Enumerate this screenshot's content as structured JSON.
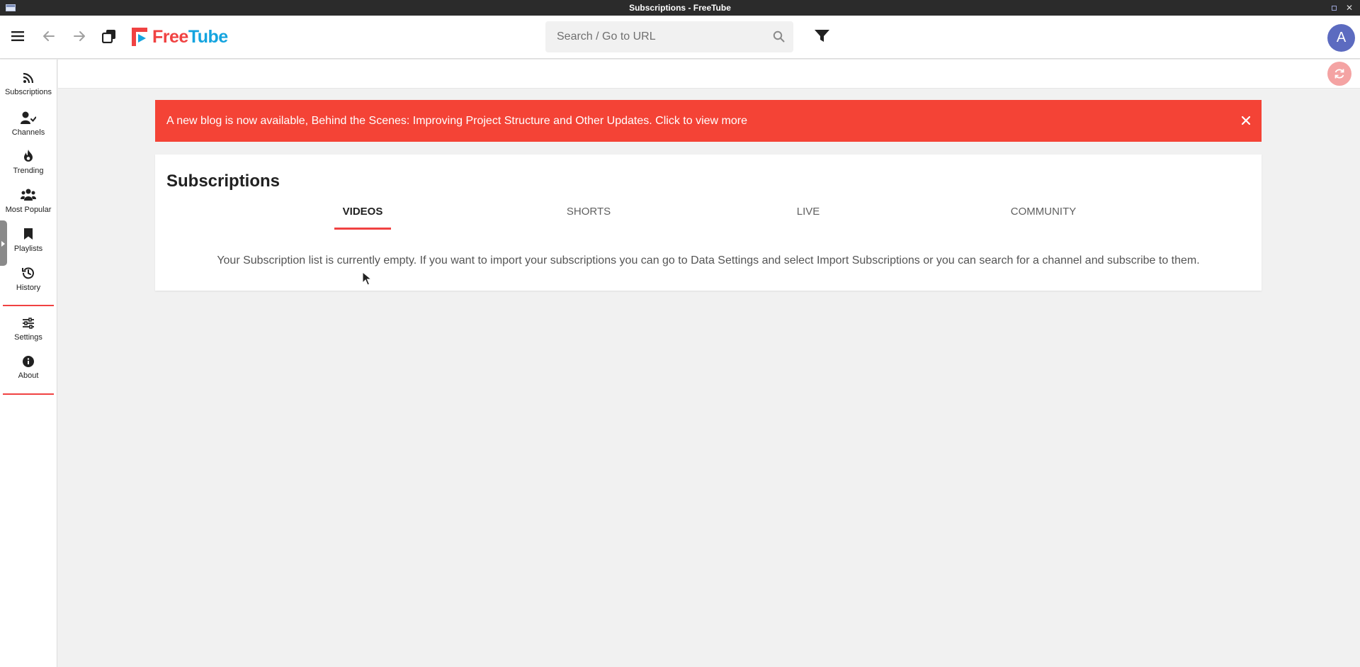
{
  "window": {
    "title": "Subscriptions - FreeTube"
  },
  "topnav": {
    "logo_free": "Free",
    "logo_tube": "Tube",
    "search_placeholder": "Search / Go to URL",
    "avatar_letter": "A"
  },
  "sidebar": {
    "items": [
      {
        "label": "Subscriptions",
        "icon": "rss-icon"
      },
      {
        "label": "Channels",
        "icon": "user-check-icon"
      },
      {
        "label": "Trending",
        "icon": "fire-icon"
      },
      {
        "label": "Most Popular",
        "icon": "users-icon"
      },
      {
        "label": "Playlists",
        "icon": "bookmark-icon"
      },
      {
        "label": "History",
        "icon": "history-icon"
      },
      {
        "label": "Settings",
        "icon": "sliders-icon"
      },
      {
        "label": "About",
        "icon": "info-circle-icon"
      }
    ]
  },
  "banner": {
    "text": "A new blog is now available, Behind the Scenes: Improving Project Structure and Other Updates. Click to view more"
  },
  "main": {
    "title": "Subscriptions",
    "tabs": [
      {
        "label": "VIDEOS",
        "active": true
      },
      {
        "label": "SHORTS",
        "active": false
      },
      {
        "label": "LIVE",
        "active": false
      },
      {
        "label": "COMMUNITY",
        "active": false
      }
    ],
    "empty_message": "Your Subscription list is currently empty. If you want to import your subscriptions you can go to Data Settings and select Import Subscriptions or you can search for a channel and subscribe to them."
  },
  "colors": {
    "accent": "#f04242",
    "banner": "#f44336",
    "logo_blue": "#14a4df",
    "avatar": "#5c6bc0",
    "refresh": "#f4a3a3"
  }
}
